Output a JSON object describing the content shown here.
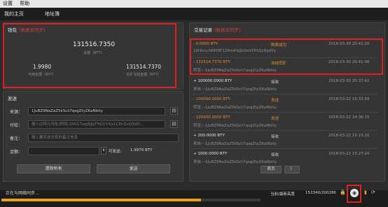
{
  "menu": {
    "settings": "设置",
    "help": "帮助"
  },
  "nav": {
    "home": "我的主页",
    "addressbook": "地址簿"
  },
  "wallet": {
    "title": "钱包",
    "sync_note": "(数据未同步)",
    "total_amount": "131516.7350",
    "total_label": "总额（BTY）",
    "available_amount": "1.9980",
    "available_label": "可用余额（BTY）",
    "frozen_amount": "131514.7370",
    "frozen_label": "挖矿冻结金额（BTY）"
  },
  "send": {
    "title": "发送",
    "from_label": "来源：",
    "from_value": "1JuBZ9NaZaZ5kScii7qsgZtyZKaNbity",
    "to_label": "付给：",
    "to_placeholder": "输入比特元地址(例如:1NS17iag9jJgTHD1VXjvLCEnZuQ3rJD...",
    "note_label": "备注：",
    "note_placeholder": "输入要发送交易的备注信息",
    "amount_label": "金额：",
    "available_label": "可发送:",
    "available_value": "1.9970 BTY",
    "clear_button": "清除所有",
    "send_button": "发送"
  },
  "transactions": {
    "title": "交易记录",
    "sync_note": "(数据未同步)",
    "items": [
      {
        "amount": "- 0.0000 BTY",
        "type": "购票成功",
        "time": "2018-03-30 20:41:20",
        "address": "16Hknv3R9YAT1ZAmKbJjkDwVDHZJcRpdVy"
      },
      {
        "amount": "- 131514.7370 BTY",
        "type": "冻结挖矿",
        "time": "2018-03-30 20:41:06",
        "address": "转至:--1JuBZ9NaZaZ5kScii7qsgZtyZKaNbity"
      },
      {
        "amount": "+ 100000.0000 BTY",
        "type": "接收",
        "time": "2018-03-30 20:37:41",
        "address": "来自:--1JuBZ9NaZaZ5kScii7qsgZtyZKaNbity"
      },
      {
        "amount": "- 200000.0000 BTY",
        "type": "发送",
        "time": "2018-03-22 15:33:58",
        "address": "转至:--1JuBZ9NaZaZ5kScii7qsgZtyZKaNbity"
      },
      {
        "amount": "- 100000.0000 BTY",
        "type": "发送",
        "time": "2018-03-22 14:36:15",
        "address": "转至:--1JuBZ9NaZaZ5kScii7qsgZtyZKaNbity"
      },
      {
        "amount": "+ 200.0000 BTY",
        "type": "接收",
        "time": "2018-03-22 15:23:15",
        "address": "来自:--1JuBZ9NaZaZ5kScii7qsgZtyZKaNbity"
      },
      {
        "amount": "+ 1000.0000 BTY",
        "type": "接收",
        "time": "2018-03-22 15:27:24",
        "address": "来自:--1JuBZ9NaZaZ5kScii7qsgZtyZKaNbity"
      }
    ],
    "first_page": "首页",
    "next_page": "〉"
  },
  "status": {
    "syncing": "正在与网络同步...",
    "height_label": "当前/最新高度",
    "height_value": "153340/200286",
    "progress": 0.77
  },
  "colors": {
    "accent": "#e8a020",
    "highlight": "#e02020"
  }
}
